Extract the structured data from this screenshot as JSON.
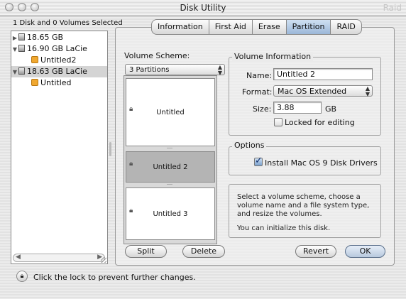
{
  "window": {
    "title": "Disk Utility",
    "ghost_title": "Raid"
  },
  "sidebar": {
    "selection_info": "1 Disk and 0 Volumes Selected",
    "items": [
      {
        "label": "18.65 GB",
        "type": "disk",
        "expanded": false
      },
      {
        "label": "16.90 GB LaCie",
        "type": "disk",
        "expanded": true
      },
      {
        "label": "Untitled2",
        "type": "volume"
      },
      {
        "label": "18.63 GB LaCie",
        "type": "disk",
        "expanded": true,
        "selected": true
      },
      {
        "label": "Untitled",
        "type": "volume"
      }
    ]
  },
  "tabs": [
    {
      "label": "Information"
    },
    {
      "label": "First Aid"
    },
    {
      "label": "Erase"
    },
    {
      "label": "Partition",
      "active": true
    },
    {
      "label": "RAID"
    }
  ],
  "volume_scheme": {
    "label": "Volume Scheme:",
    "selected": "3 Partitions",
    "partitions": [
      "Untitled",
      "Untitled 2",
      "Untitled 3"
    ],
    "selected_partition": "Untitled 2"
  },
  "volume_info": {
    "group_label": "Volume Information",
    "name_label": "Name:",
    "name_value": "Untitled 2",
    "format_label": "Format:",
    "format_value": "Mac OS Extended",
    "size_label": "Size:",
    "size_value": "3.88",
    "size_unit": "GB",
    "locked_label": "Locked for editing",
    "locked_checked": false
  },
  "options": {
    "group_label": "Options",
    "install_drivers_label": "Install Mac OS 9 Disk Drivers",
    "install_drivers_checked": true
  },
  "help_text": {
    "line1": "Select a volume scheme, choose a volume name and a file system type, and resize the volumes.",
    "line2": "You can initialize this disk."
  },
  "buttons": {
    "split": "Split",
    "delete": "Delete",
    "revert": "Revert",
    "ok": "OK"
  },
  "footer": {
    "lock_text": "Click the lock to prevent further changes."
  }
}
